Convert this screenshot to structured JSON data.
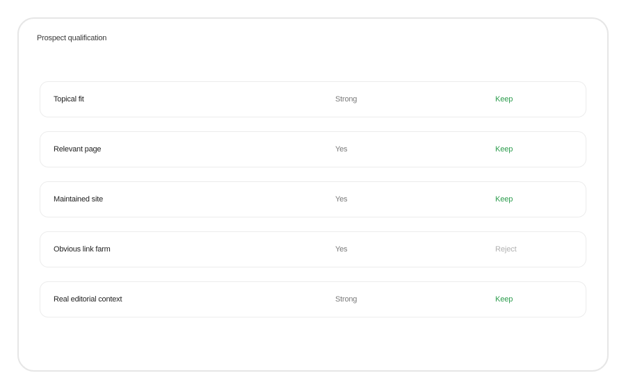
{
  "card": {
    "title": "Prospect qualification"
  },
  "rows": [
    {
      "label": "Topical fit",
      "value": "Strong",
      "decision": "Keep",
      "status": "keep"
    },
    {
      "label": "Relevant page",
      "value": "Yes",
      "decision": "Keep",
      "status": "keep"
    },
    {
      "label": "Maintained site",
      "value": "Yes",
      "decision": "Keep",
      "status": "keep"
    },
    {
      "label": "Obvious link farm",
      "value": "Yes",
      "decision": "Reject",
      "status": "reject"
    },
    {
      "label": "Real editorial context",
      "value": "Strong",
      "decision": "Keep",
      "status": "keep"
    }
  ],
  "colors": {
    "keep": "#2c9c4d",
    "reject": "#b0b0b0"
  }
}
